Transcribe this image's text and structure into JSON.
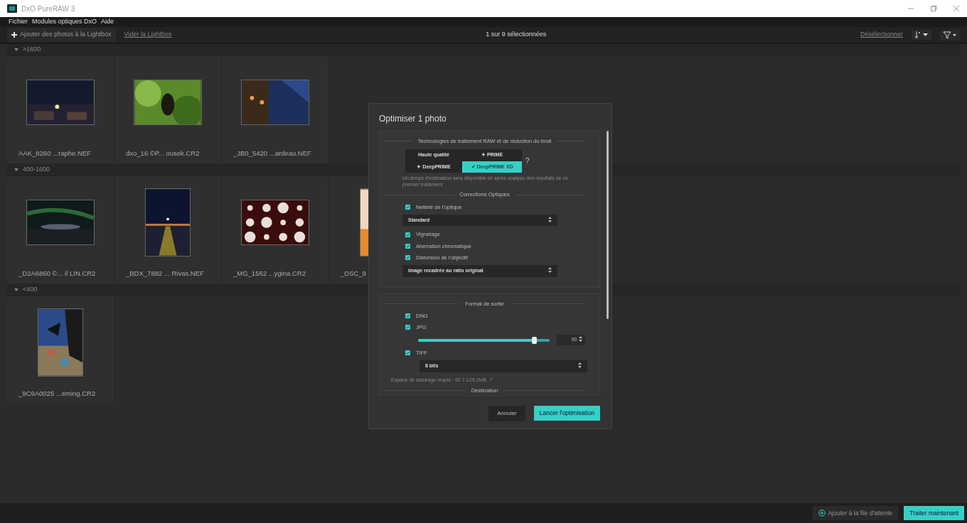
{
  "window": {
    "title": "DxO PureRAW 3"
  },
  "menu": [
    {
      "label": "Fichier"
    },
    {
      "label": "Modules optiques DxO"
    },
    {
      "label": "Aide"
    }
  ],
  "toolbar": {
    "add_button": "Ajouter des photos à la Lightbox",
    "clear_link": "Vider la Lightbox",
    "selection_count": "1 sur 9 sélectionnées",
    "deselect_link": "Désélectionner"
  },
  "groups": [
    {
      "label": ">1600",
      "expanded": true,
      "photos": [
        {
          "name": "AAK_8260 ...raphe.NEF"
        },
        {
          "name": "dxo_16 ©P... ousek.CR2"
        },
        {
          "name": "_JB0_5420 ...ardeau.NEF"
        }
      ]
    },
    {
      "label": "400-1600",
      "expanded": true,
      "photos": [
        {
          "name": "_D2A6860 ©... il LIN.CR2"
        },
        {
          "name": "_BDX_7882 ... Rivas.NEF"
        },
        {
          "name": "_MG_1562 ...ygina.CR2"
        },
        {
          "name": "_DSC_9"
        }
      ]
    },
    {
      "label": "<400",
      "expanded": true,
      "photos": [
        {
          "name": "_9C9A0025 ...eming.CR2"
        }
      ]
    }
  ],
  "dialog": {
    "title": "Optimiser 1 photo",
    "processing": {
      "heading": "Technologies de traitement RAW et de réduction du bruit",
      "options": [
        {
          "label": "Haute qualité",
          "selected": false
        },
        {
          "label": "✦ PRIME",
          "selected": false
        },
        {
          "label": "✦ DeepPRIME",
          "selected": false
        },
        {
          "label": "✔ DeepPRIME XD",
          "selected": true
        }
      ],
      "help": "?",
      "hint": "Un temps d'estimation sera disponible ici après analyse des résultats de ce premier traitement"
    },
    "optics": {
      "heading": "Corrections Optiques",
      "items": [
        {
          "kind": "checkbox",
          "label": "Netteté de l'optique",
          "checked": true
        },
        {
          "kind": "select",
          "value": "Standard"
        },
        {
          "kind": "checkbox",
          "label": "Vignetage",
          "checked": true
        },
        {
          "kind": "checkbox",
          "label": "Aberration chromatique",
          "checked": true
        },
        {
          "kind": "checkbox",
          "label": "Distorsion de l'objectif",
          "checked": true
        },
        {
          "kind": "select",
          "value": "Image recadrée au ratio original"
        }
      ]
    },
    "output": {
      "heading": "Format de sortie",
      "items": [
        {
          "kind": "checkbox",
          "label": "DNG",
          "checked": true
        },
        {
          "kind": "checkbox",
          "label": "JPG",
          "checked": true
        },
        {
          "kind": "slider",
          "level": 0.88,
          "value": "90"
        },
        {
          "kind": "checkbox",
          "label": "TIFF",
          "checked": true
        },
        {
          "kind": "select",
          "value": "8 bits"
        }
      ],
      "storage": "Espace de stockage requis : 92.7-129.1MB",
      "help": "?"
    },
    "destination_heading": "Destination",
    "cancel_button": "Annuler",
    "start_button": "Lancer l'optimisation"
  },
  "footer": {
    "queue_button": "Ajouter à la file d'attente",
    "process_button": "Traiter maintenant"
  }
}
